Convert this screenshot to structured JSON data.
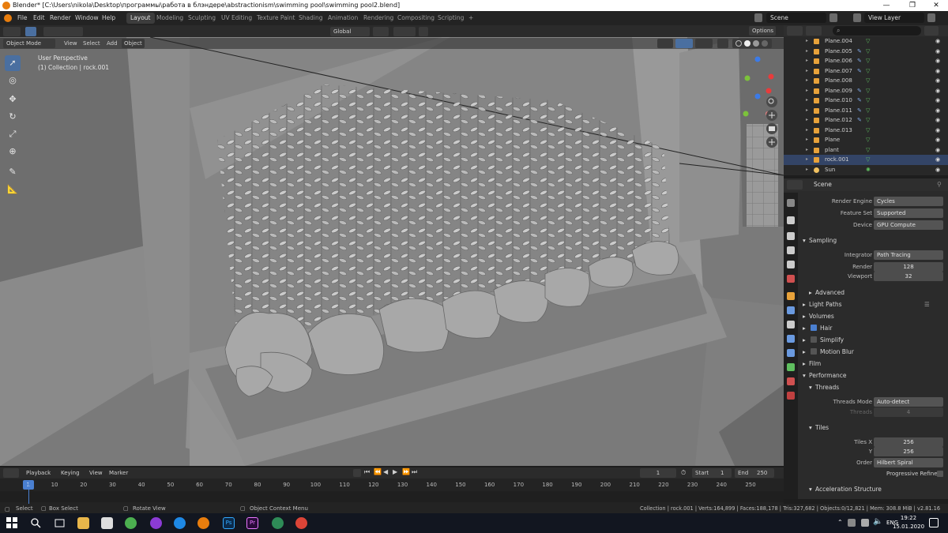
{
  "titlebar": {
    "title": "Blender* [C:\\Users\\nikola\\Desktop\\программы\\работа в блэндере\\abstractionism\\swimming pool\\swimming pool2.blend]",
    "minimize": "—",
    "maximize": "❐",
    "close": "✕"
  },
  "menubar": {
    "menus": [
      "File",
      "Edit",
      "Render",
      "Window",
      "Help"
    ],
    "workspaces": [
      "Layout",
      "Modeling",
      "Sculpting",
      "UV Editing",
      "Texture Paint",
      "Shading",
      "Animation",
      "Rendering",
      "Compositing",
      "Scripting"
    ],
    "add_tab": "+",
    "scene_label": "Scene",
    "view_layer_label": "View Layer"
  },
  "viewport_header": {
    "mode": "Object Mode",
    "menus": [
      "View",
      "Select",
      "Add",
      "Object"
    ],
    "transform_orientation": "Global",
    "options": "Options"
  },
  "viewport": {
    "perspective": "User Perspective",
    "collection": "(1) Collection | rock.001"
  },
  "outliner": {
    "search_placeholder": "",
    "rows": [
      {
        "name": "Plane.004",
        "mod": false,
        "mesh": true,
        "sel": false
      },
      {
        "name": "Plane.005",
        "mod": true,
        "mesh": true,
        "sel": false
      },
      {
        "name": "Plane.006",
        "mod": true,
        "mesh": true,
        "sel": false
      },
      {
        "name": "Plane.007",
        "mod": true,
        "mesh": true,
        "sel": false
      },
      {
        "name": "Plane.008",
        "mod": false,
        "mesh": true,
        "sel": false
      },
      {
        "name": "Plane.009",
        "mod": true,
        "mesh": true,
        "sel": false
      },
      {
        "name": "Plane.010",
        "mod": true,
        "mesh": true,
        "sel": false
      },
      {
        "name": "Plane.011",
        "mod": true,
        "mesh": true,
        "sel": false
      },
      {
        "name": "Plane.012",
        "mod": true,
        "mesh": true,
        "sel": false
      },
      {
        "name": "Plane.013",
        "mod": false,
        "mesh": true,
        "sel": false
      },
      {
        "name": "Plane",
        "mod": false,
        "mesh": true,
        "sel": false
      },
      {
        "name": "plant",
        "mod": false,
        "mesh": true,
        "sel": false
      },
      {
        "name": "rock.001",
        "mod": false,
        "mesh": true,
        "sel": true
      },
      {
        "name": "Sun",
        "mod": false,
        "mesh": false,
        "sel": false
      }
    ]
  },
  "properties": {
    "context": "Scene",
    "render_engine_label": "Render Engine",
    "render_engine": "Cycles",
    "feature_set_label": "Feature Set",
    "feature_set": "Supported",
    "device_label": "Device",
    "device": "GPU Compute",
    "sampling": "Sampling",
    "integrator_label": "Integrator",
    "integrator": "Path Tracing",
    "render_label": "Render",
    "render_samples": "128",
    "viewport_label": "Viewport",
    "viewport_samples": "32",
    "advanced": "Advanced",
    "light_paths": "Light Paths",
    "volumes": "Volumes",
    "hair": "Hair",
    "hair_checked": true,
    "simplify": "Simplify",
    "simplify_checked": false,
    "motion_blur": "Motion Blur",
    "motion_blur_checked": false,
    "film": "Film",
    "performance": "Performance",
    "threads": "Threads",
    "threads_mode_label": "Threads Mode",
    "threads_mode": "Auto-detect",
    "threads_count_label": "Threads",
    "threads_count": "4",
    "tiles": "Tiles",
    "tiles_x_label": "Tiles X",
    "tiles_x": "256",
    "tiles_y_label": "Y",
    "tiles_y": "256",
    "order_label": "Order",
    "order": "Hilbert Spiral",
    "progressive_refine": "Progressive Refine",
    "progressive_refine_checked": false,
    "acceleration": "Acceleration Structure"
  },
  "timeline": {
    "menus": [
      "Playback",
      "Keying",
      "View",
      "Marker"
    ],
    "current_frame": "1",
    "start_label": "Start",
    "start": "1",
    "end_label": "End",
    "end": "250",
    "ticks": [
      "1",
      "10",
      "20",
      "30",
      "40",
      "50",
      "60",
      "70",
      "80",
      "90",
      "100",
      "110",
      "120",
      "130",
      "140",
      "150",
      "160",
      "170",
      "180",
      "190",
      "200",
      "210",
      "220",
      "230",
      "240",
      "250"
    ]
  },
  "statusbar": {
    "select": "Select",
    "box_select": "Box Select",
    "rotate_view": "Rotate View",
    "context_menu": "Object Context Menu",
    "stats": "Collection | rock.001 | Verts:164,899 | Faces:188,178 | Tris:327,682 | Objects:0/12,821 | Mem: 308.8 MiB | v2.81.16"
  },
  "taskbar": {
    "language": "ENG",
    "time": "19:22",
    "date": "15.01.2020",
    "ps_label": "Ps",
    "pr_label": "Pr"
  },
  "colors": {
    "blender_orange": "#e87d0d",
    "selection_blue": "#4a6fa0",
    "mesh_green": "#5fbf5f"
  }
}
